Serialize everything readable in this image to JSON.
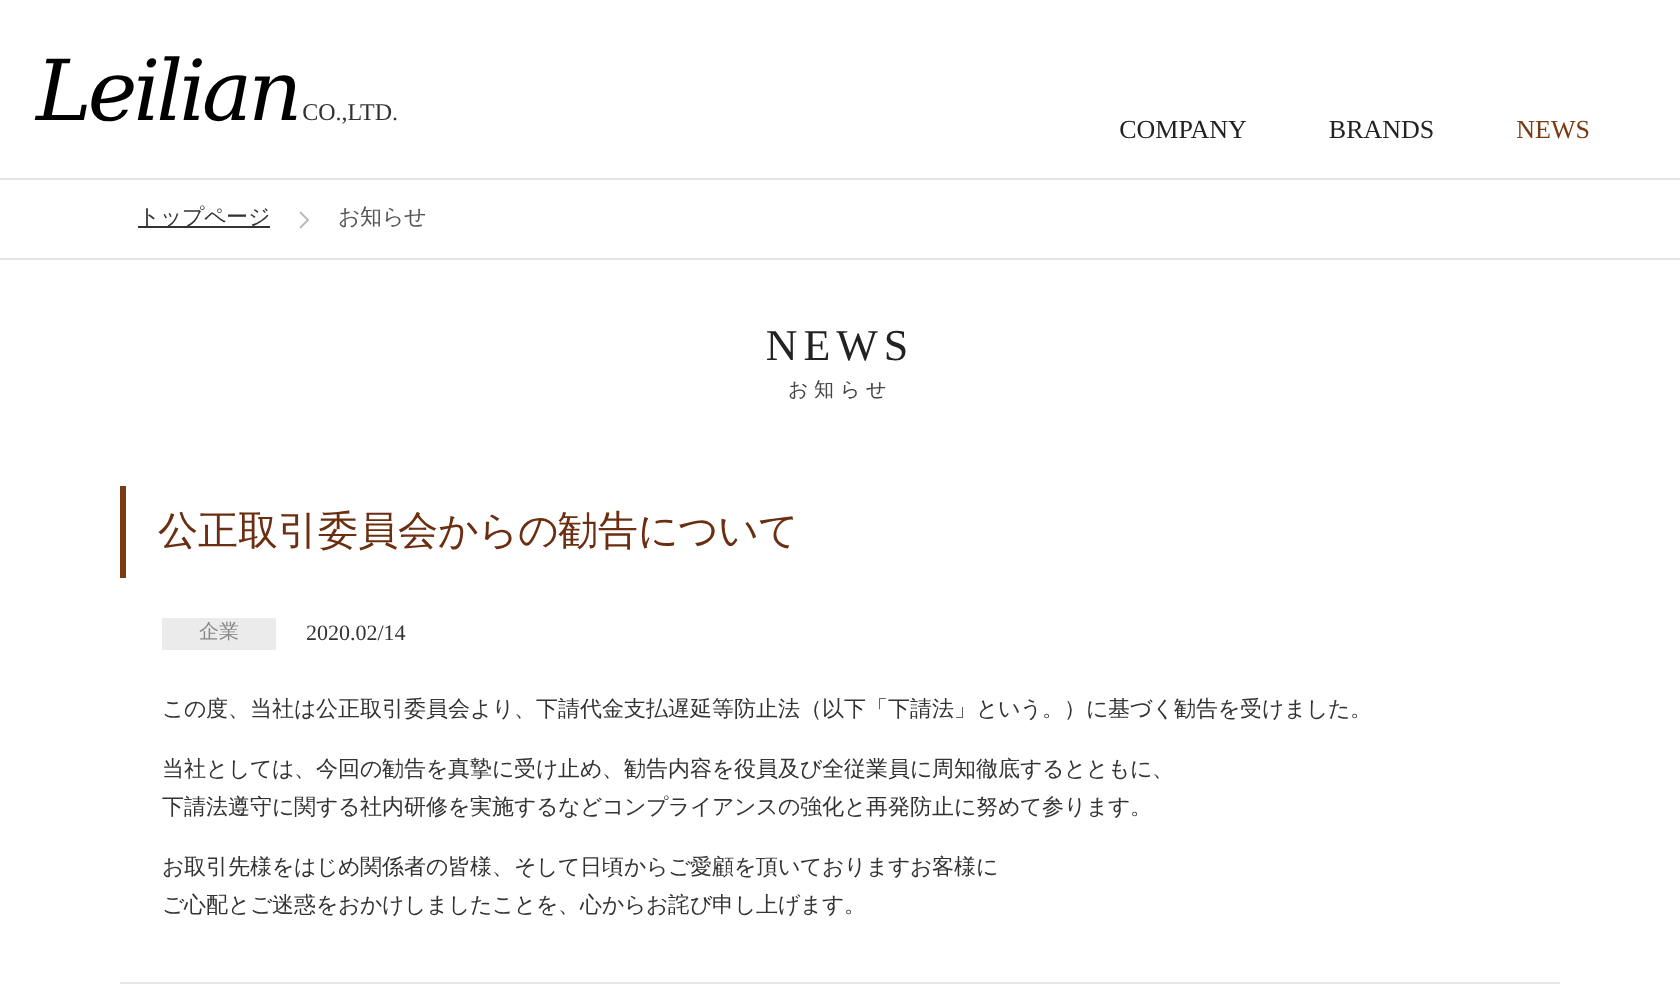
{
  "logo": {
    "name": "Leilian",
    "suffix": "CO.,LTD."
  },
  "nav": [
    {
      "label": "COMPANY",
      "selected": false
    },
    {
      "label": "BRANDS",
      "selected": false
    },
    {
      "label": "NEWS",
      "selected": true
    }
  ],
  "breadcrumb": [
    {
      "label": "トップページ",
      "kind": "link"
    },
    {
      "label": "お知らせ",
      "kind": "current"
    }
  ],
  "page_title": {
    "title": "NEWS",
    "subtitle": "お知らせ"
  },
  "article": {
    "title": "公正取引委員会からの勧告について",
    "category": "企業",
    "date": "2020.02/14",
    "paragraphs": [
      [
        "この度、当社は公正取引委員会より、下請代金支払遅延等防止法（以下「下請法」という。）に基づく勧告を受けました。"
      ],
      [
        "当社としては、今回の勧告を真摯に受け止め、勧告内容を役員及び全従業員に周知徹底するとともに、",
        "下請法遵守に関する社内研修を実施するなどコンプライアンスの強化と再発防止に努めて参ります。"
      ],
      [
        "お取引先様をはじめ関係者の皆様、そして日頃からご愛顧を頂いておりますお客様に",
        "ご心配とご迷惑をおかけしましたことを、心からお詫び申し上げます。"
      ]
    ]
  }
}
